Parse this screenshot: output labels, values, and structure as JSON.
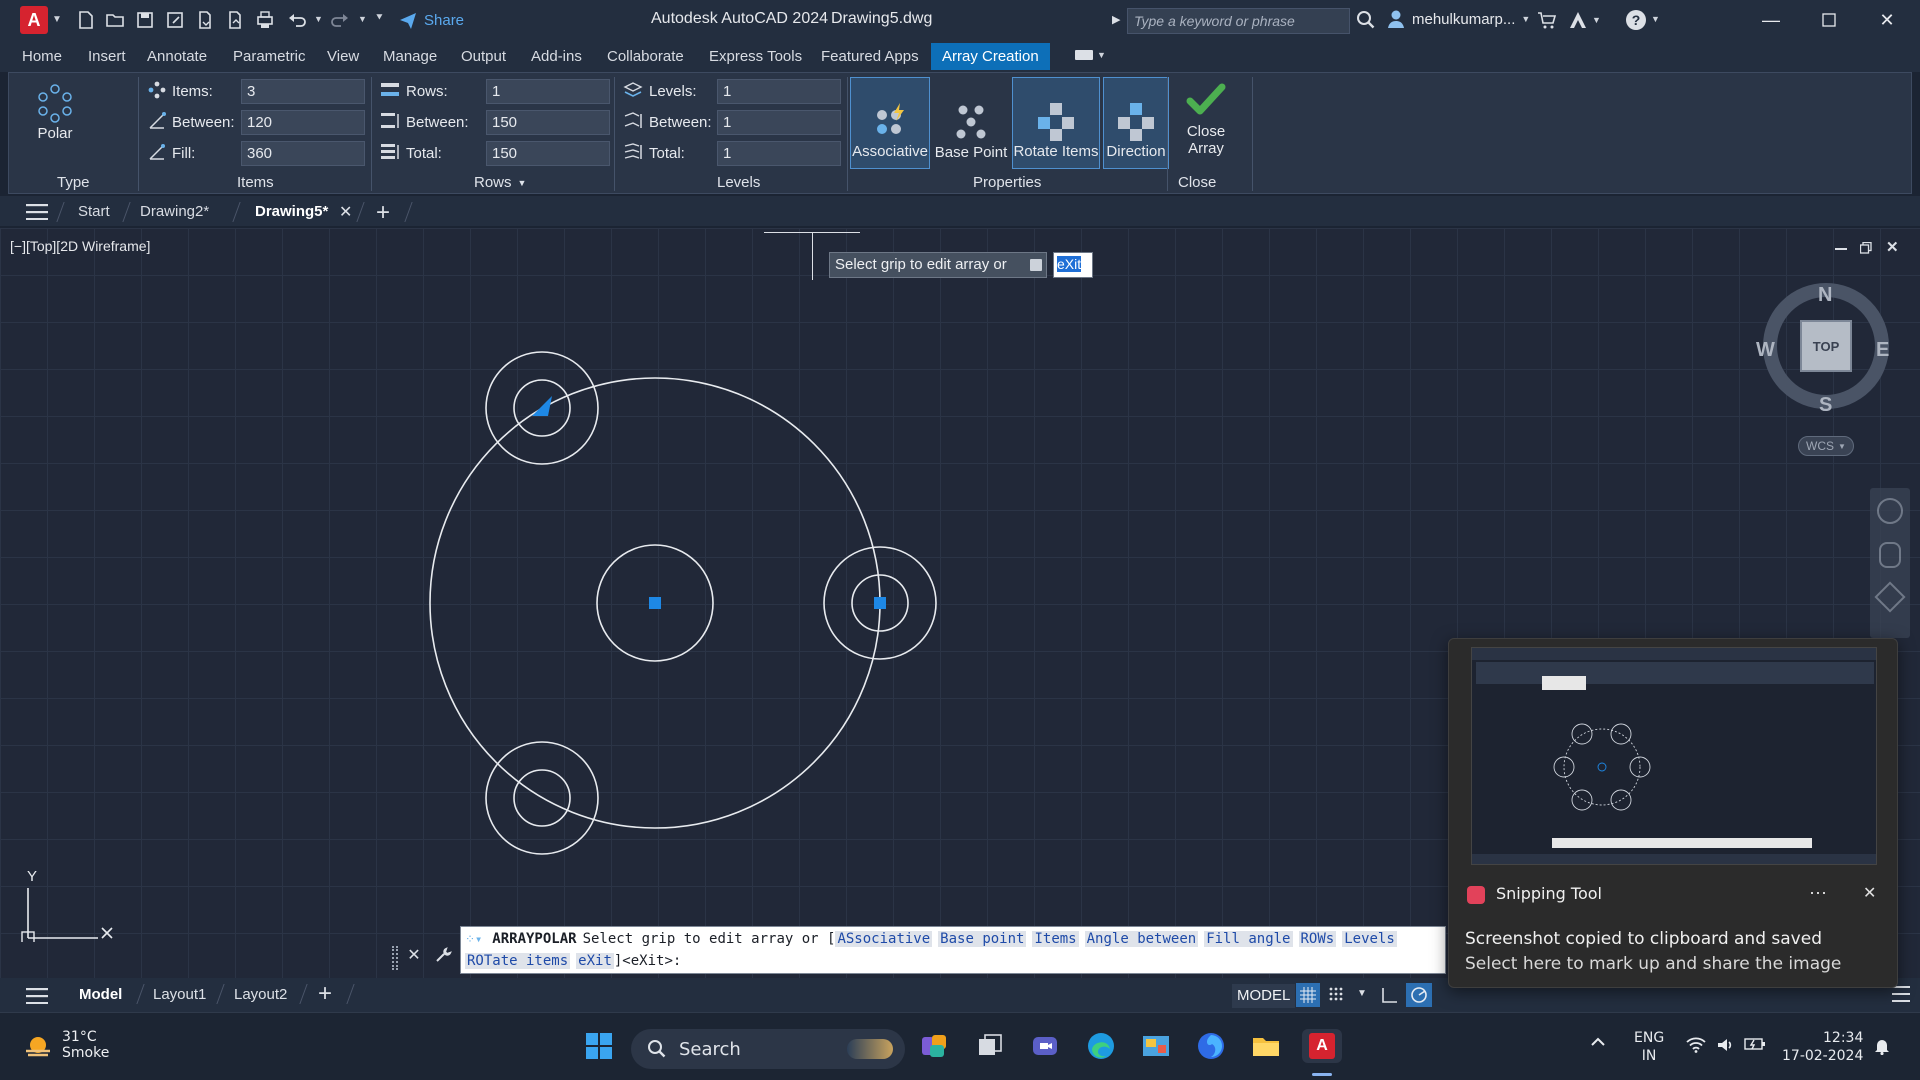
{
  "titlebar": {
    "app_title": "Autodesk AutoCAD 2024",
    "file_name": "Drawing5.dwg",
    "share_label": "Share",
    "search_placeholder": "Type a keyword or phrase",
    "user_name": "mehulkumarp...",
    "app_letter": "A"
  },
  "ribbon_tabs": [
    "Home",
    "Insert",
    "Annotate",
    "Parametric",
    "View",
    "Manage",
    "Output",
    "Add-ins",
    "Collaborate",
    "Express Tools",
    "Featured Apps",
    "Array Creation"
  ],
  "ribbon": {
    "type_panel": {
      "button_label": "Polar",
      "panel_label": "Type"
    },
    "items_panel": {
      "panel_label": "Items",
      "items_label": "Items:",
      "items_value": "3",
      "between_label": "Between:",
      "between_value": "120",
      "fill_label": "Fill:",
      "fill_value": "360"
    },
    "rows_panel": {
      "panel_label": "Rows",
      "rows_label": "Rows:",
      "rows_value": "1",
      "between_label": "Between:",
      "between_value": "150",
      "total_label": "Total:",
      "total_value": "150"
    },
    "levels_panel": {
      "panel_label": "Levels",
      "levels_label": "Levels:",
      "levels_value": "1",
      "between_label": "Between:",
      "between_value": "1",
      "total_label": "Total:",
      "total_value": "1"
    },
    "properties_panel": {
      "panel_label": "Properties",
      "associative_label": "Associative",
      "base_point_label": "Base Point",
      "rotate_items_label": "Rotate Items",
      "direction_label": "Direction"
    },
    "close_panel": {
      "panel_label": "Close",
      "close_label_1": "Close",
      "close_label_2": "Array"
    }
  },
  "doc_tabs": [
    "Start",
    "Drawing2*",
    "Drawing5*"
  ],
  "viewport": {
    "label": "[−][Top][2D Wireframe]",
    "prompt_text": "Select grip to edit array or",
    "prompt_input": "eXit",
    "compass": {
      "n": "N",
      "s": "S",
      "e": "E",
      "w": "W",
      "cube": "TOP",
      "wcs": "WCS"
    },
    "ucs_y": "Y"
  },
  "command_line": {
    "command": "ARRAYPOLAR",
    "text": "Select grip to edit array or [",
    "options_row1": [
      "ASsociative",
      "Base point",
      "Items",
      "Angle between",
      "Fill angle",
      "ROWs",
      "Levels"
    ],
    "options_row2": [
      "ROTate items",
      "eXit"
    ],
    "tail": "]<eXit>:"
  },
  "status_bar": {
    "tabs": [
      "Model",
      "Layout1",
      "Layout2"
    ],
    "model_label": "MODEL"
  },
  "toast": {
    "app": "Snipping Tool",
    "message": "Screenshot copied to clipboard and saved",
    "sub": "Select here to mark up and share the image",
    "more": "⋯"
  },
  "taskbar": {
    "weather_temp": "31°C",
    "weather_desc": "Smoke",
    "search_label": "Search",
    "lang_1": "ENG",
    "lang_2": "IN",
    "time": "12:34",
    "date": "17-02-2024"
  },
  "colors": {
    "accent": "#0d6fb8",
    "grip_blue": "#1e88e5",
    "canvas": "#212838",
    "check_green": "#4caf50"
  }
}
